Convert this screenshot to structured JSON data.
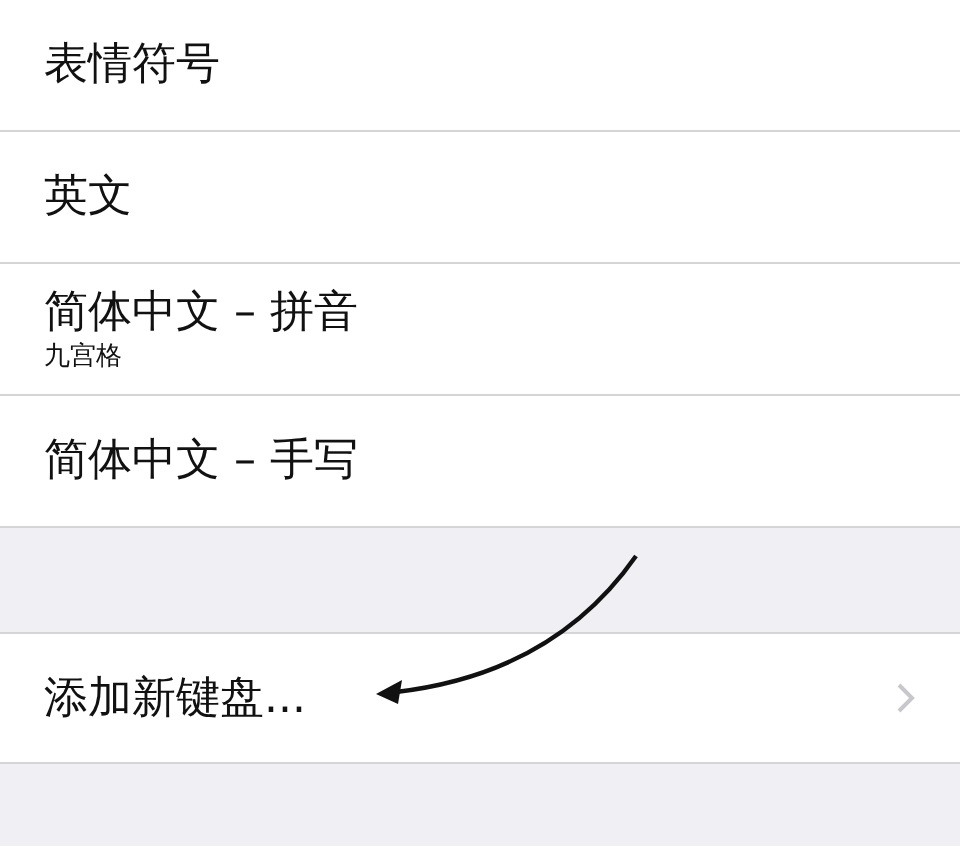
{
  "keyboards": [
    {
      "title": "表情符号"
    },
    {
      "title": "英文"
    },
    {
      "title": "简体中文 – 拼音",
      "subtitle": "九宫格"
    },
    {
      "title": "简体中文 – 手写"
    }
  ],
  "add_keyboard": {
    "label": "添加新键盘..."
  }
}
